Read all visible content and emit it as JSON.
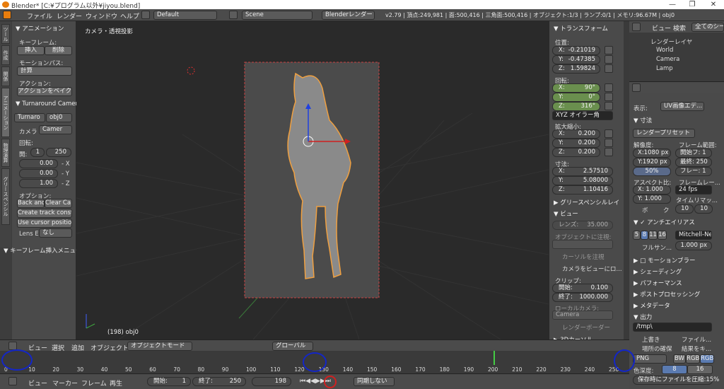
{
  "window": {
    "title": "Blender* [C:¥プログラム以外¥jiyou.blend]",
    "minimize": "—",
    "maximize": "❐",
    "close": "✕"
  },
  "menubar": {
    "items": [
      "ファイル",
      "レンダー",
      "ウィンドウ",
      "ヘルプ"
    ],
    "layout": "Default",
    "scene": "Scene",
    "engine": "Blenderレンダー",
    "stats": "v2.79 | 頂点:249,981 | 面:500,416 | 三角面:500,416 | オブジェクト:1/3 | ランプ:0/1 | メモリ:96.67M | obj0"
  },
  "left": {
    "tabs": [
      "ツール",
      "作成",
      "関係",
      "アニメーション",
      "物理演算",
      "グリースペンシル"
    ],
    "animation_header": "▼ アニメーション",
    "keyframes_label": "キーフレーム:",
    "insert": "挿入",
    "delete": "削除",
    "motion_paths_label": "モーションパス:",
    "calculate": "計算",
    "action_label": "アクション:",
    "bake_action": "アクションをベイク",
    "turnaround_header": "▼ Turnaround Camera",
    "turnaround_obj": "Turnaro",
    "obj0": "obj0",
    "camera_label": "カメラ",
    "camera_value": "Camer",
    "rotation_label": "回転:",
    "start_label": "開:",
    "start_value": "1",
    "end_value": "250",
    "x_label": "X:",
    "x_value": "0.00",
    "x_dir": "- X",
    "y_label": "Y:",
    "y_value": "0.00",
    "y_dir": "- Y",
    "z_label": "Z:",
    "z_value": "1.00",
    "z_dir": "- Z",
    "options_label": "オプション:",
    "back_and": "Back and...",
    "clear_ca": "Clear Ca...",
    "create_track": "Create track constraint",
    "use_cursor": "Use cursor position",
    "lens_label": "Lens E",
    "lens_value": "なし",
    "keyframe_insert_menu": "▼ キーフレーム挿入メニュー"
  },
  "viewport": {
    "view_name": "カメラ・透視投影",
    "object_label": "(198) obj0"
  },
  "npanel": {
    "transform_header": "▼ トランスフォーム",
    "location_label": "位置:",
    "loc_x": "-0.21019",
    "loc_y": "-0.47385",
    "loc_z": "1.59824",
    "rotation_label": "回転:",
    "rot_x": "90°",
    "rot_y": "0°",
    "rot_z": "316°",
    "rotation_mode": "XYZ オイラー角",
    "scale_label": "拡大縮小:",
    "scale_x": "0.200",
    "scale_y": "0.200",
    "scale_z": "0.200",
    "dimensions_label": "寸法:",
    "dim_x": "2.57510",
    "dim_y": "5.08000",
    "dim_z": "1.10416",
    "axis_x": "X:",
    "axis_y": "Y:",
    "axis_z": "Z:",
    "grease_pencil": "▶ グリースペンシルレイ",
    "view_header": "▼ ビュー",
    "lens_label": "レンズ:",
    "lens_value": "35.000",
    "lock_object": "オブジェクトに注視:",
    "lock_cursor": "カーソルを注視",
    "lock_camera": "カメラをビューにロ...",
    "clip_label": "クリップ:",
    "clip_start_label": "開始:",
    "clip_start": "0.100",
    "clip_end_label": "終了:",
    "clip_end": "1000.000",
    "local_camera": "ローカルカメラ:",
    "camera_value": "Camera",
    "render_border": "レンダーボーダー",
    "cursor_3d": "▶ 3Dカーソル"
  },
  "outliner": {
    "view": "ビュー",
    "search": "検索",
    "scenes": "全てのシーン",
    "items": [
      "レンダーレイヤ",
      "World",
      "Camera",
      "Lamp"
    ]
  },
  "properties": {
    "display_label": "表示:",
    "display_value": "UV画像エデ...",
    "dimensions_header": "▼ 寸法",
    "render_presets": "レンダープリセット",
    "resolution_label": "解像度:",
    "res_x": "X:1080 px",
    "res_y": "Y:1920 px",
    "res_pct": "50%",
    "frame_range_label": "フレーム範囲:",
    "frame_start": "開始フ: 1",
    "frame_end": "最終: 250",
    "frame_step": "フレー: 1",
    "aspect_label": "アスペクト比:",
    "aspect_x": "X: 1.000",
    "aspect_y": "Y: 1.000",
    "frame_rate_label": "フレームレー...",
    "fps": "24 fps",
    "time_remap": "タイムリマッ...",
    "remap_old": "10",
    "remap_new": "10",
    "border": "ボ",
    "crop": "ク",
    "antialias_header": "▼ ✓ アンチエイリアス",
    "aa_samples": [
      "5",
      "8",
      "11",
      "16"
    ],
    "aa_filter": "Mitchell-Ne...",
    "full_sample": "フルサン...",
    "filter_size": "1.000 px",
    "motion_blur": "▶ □ モーションブラー",
    "shading": "▶ シェーディング",
    "performance": "▶ パフォーマンス",
    "postprocess": "▶ ポストプロセッシング",
    "metadata": "▶ メタデータ",
    "output_header": "▼ 出力",
    "output_path": "/tmp\\",
    "overwrite": "上書き",
    "file_ext": "ファイル...",
    "placeholders": "場所の確保",
    "cache": "結果をキ...",
    "format": "PNG",
    "bw": "BW",
    "rgb": "RGB",
    "rgba": "RGBA",
    "color_depth_label": "色深度:",
    "depth_8": "8",
    "depth_16": "16",
    "compression": "保存時にファイルを圧縮:15%"
  },
  "viewport_header": {
    "view": "ビュー",
    "select": "選択",
    "add": "追加",
    "object": "オブジェクト",
    "mode": "オブジェクトモード",
    "orientation": "グローバル"
  },
  "timeline": {
    "ticks": [
      "0",
      "10",
      "20",
      "30",
      "40",
      "50",
      "60",
      "70",
      "80",
      "90",
      "100",
      "110",
      "120",
      "130",
      "140",
      "150",
      "160",
      "170",
      "180",
      "190",
      "200",
      "210",
      "220",
      "230",
      "240",
      "250"
    ],
    "current_frame": "198"
  },
  "timeline_header": {
    "view": "ビュー",
    "marker": "マーカー",
    "frame": "フレーム",
    "playback": "再生",
    "start": "開始:",
    "start_value": "1",
    "end": "終了:",
    "end_value": "250",
    "current": "198",
    "sync": "同期しない"
  }
}
